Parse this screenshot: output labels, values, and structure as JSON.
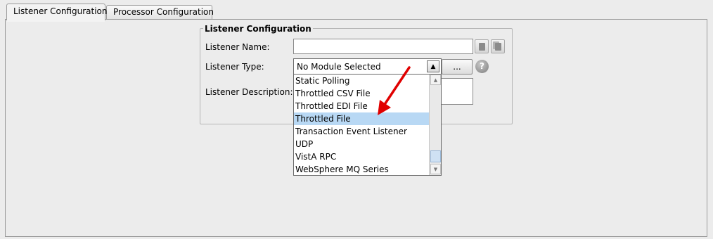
{
  "tabs": [
    {
      "label": "Listener Configuration",
      "active": true
    },
    {
      "label": "Processor Configuration",
      "active": false
    }
  ],
  "listener": {
    "group_title": "Listener Configuration",
    "name_label": "Listener Name:",
    "name_value": "",
    "type_label": "Listener Type:",
    "type_selected": "No Module Selected",
    "ellipsis_button": "...",
    "help_icon_text": "?",
    "description_label": "Listener Description:",
    "description_value": ""
  },
  "dropdown": {
    "items": [
      "Static Polling",
      "Throttled CSV File",
      "Throttled EDI File",
      "Throttled File",
      "Transaction Event Listener",
      "UDP",
      "VistA RPC",
      "WebSphere MQ Series"
    ],
    "highlighted": "Throttled File",
    "scroll_position": 0.85
  },
  "colors": {
    "highlight": "#b8d8f4",
    "annotation_arrow": "#e00000"
  },
  "icons": {
    "copy": "copy-icon",
    "paste": "paste-icon",
    "help": "help-icon",
    "combo_arrow": "triangle-up-icon"
  }
}
